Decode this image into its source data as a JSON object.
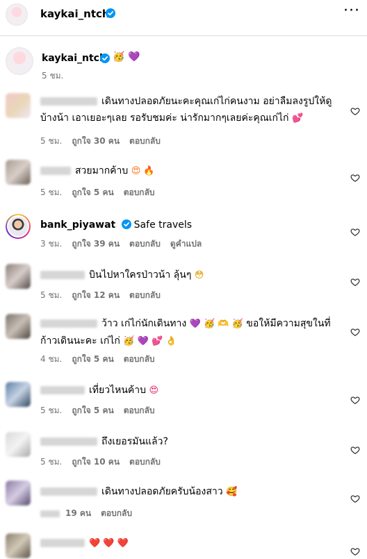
{
  "header": {
    "username": "kaykai_ntch",
    "more_label": "···"
  },
  "caption": {
    "username": "kaykai_ntch",
    "emoji_party": "🥳",
    "emoji_heart": "💜",
    "time": "5 ชม."
  },
  "labels": {
    "reply": "ตอบกลับ",
    "see_translation": "ดูคำแปล"
  },
  "comments": [
    {
      "text": "เดินทางปลอดภัยนะคะคุณเก่ไก่คนงาม อย่าลืมลงรูปให้ดูบ้างน้า เอาเยอะๆเลย รอรับชมค่ะ น่ารักมากๆเลยค่ะคุณเก่ไก่",
      "emoji": "💕",
      "time": "5 ชม.",
      "likes": "ถูกใจ 30 คน"
    },
    {
      "text": "สวยมากค้าบ",
      "emoji": "😍 🔥",
      "time": "5 ชม.",
      "likes": "ถูกใจ 5 คน"
    },
    {
      "username": "bank_piyawat",
      "text": "Safe travels",
      "time": "3 ชม.",
      "likes": "ถูกใจ 39 คน"
    },
    {
      "text": "บินไปหาใครป่าวน้า ลุ้นๆ",
      "emoji": "😳",
      "time": "5 ชม.",
      "likes": "ถูกใจ 12 คน"
    },
    {
      "text_a": "ว้าว เก่ไก่นักเดินทาง",
      "emoji_a": "💜 🥳 🫶 🥳",
      "text_b": "ขอให้มีความสุขในที่ก้าวเดินนะคะ เก่ไก่",
      "emoji_b": "🥳 💜 💕 👌",
      "time": "4 ชม.",
      "likes": "ถูกใจ 5 คน"
    },
    {
      "text": "เที่ยวไหนค้าบ",
      "emoji": "😍",
      "time": "5 ชม.",
      "likes": "ถูกใจ 5 คน"
    },
    {
      "text": "ถึงเยอรมันแล้ว?",
      "time": "5 ชม.",
      "likes": "ถูกใจ 10 คน"
    },
    {
      "text": "เดินทางปลอดภัยครับน้องสาว",
      "emoji": "🥰",
      "likes": "19 คน"
    },
    {
      "emoji": "❤️ ❤️ ❤️"
    }
  ],
  "colors": {
    "muted": "#737373",
    "verified": "#0095f6",
    "divider": "#dbdbdb"
  },
  "icons": [
    "verified-badge-icon",
    "more-options-icon",
    "heart-outline-icon"
  ]
}
